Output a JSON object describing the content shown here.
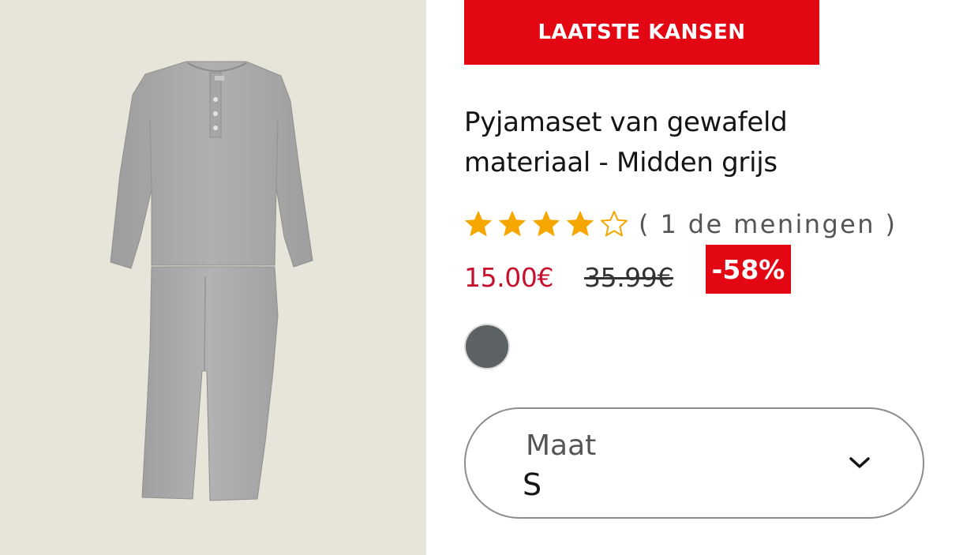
{
  "product_image": {
    "alt": "",
    "background": "#e7e5da",
    "garment_color": "#a9a9a9"
  },
  "promo_banner": {
    "label": "LAATSTE KANSEN",
    "color": "#e30613"
  },
  "product": {
    "title_line1": "Pyjamaset van gewafeld",
    "title_line2": "materiaal - Midden grijs"
  },
  "rating": {
    "value": 4,
    "max": 5,
    "star_color": "#f5a700",
    "reviews_text": "( 1 de meningen )"
  },
  "price": {
    "current": "15.00€",
    "old": "35.99€",
    "discount": "-58%",
    "current_color": "#c8102e"
  },
  "color_options": {
    "selected_color": "#5c6164",
    "selected_icon": "color-swatch"
  },
  "size_select": {
    "label": "Maat",
    "value": "S",
    "icon": "chevron-down-icon"
  }
}
